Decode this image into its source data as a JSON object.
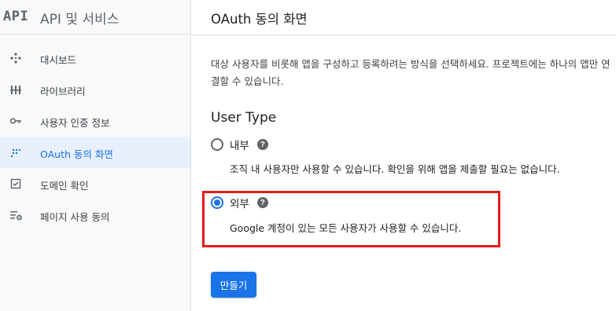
{
  "sidebar": {
    "logo": "API",
    "title": "API 및 서비스",
    "items": [
      {
        "label": "대시보드",
        "icon": "dashboard-icon"
      },
      {
        "label": "라이브러리",
        "icon": "library-icon"
      },
      {
        "label": "사용자 인증 정보",
        "icon": "key-icon"
      },
      {
        "label": "OAuth 동의 화면",
        "icon": "oauth-consent-icon",
        "active": true
      },
      {
        "label": "도메인 확인",
        "icon": "checkbox-icon"
      },
      {
        "label": "페이지 사용 동의",
        "icon": "settings-list-icon"
      }
    ]
  },
  "main": {
    "title": "OAuth 동의 화면",
    "description": "대상 사용자를 비롯해 앱을 구성하고 등록하려는 방식을 선택하세요. 프로젝트에는 하나의 앱만 연결할 수 있습니다.",
    "user_type": {
      "heading": "User Type",
      "options": [
        {
          "label": "내부",
          "description": "조직 내 사용자만 사용할 수 있습니다. 확인을 위해 앱을 제출할 필요는 없습니다.",
          "selected": false
        },
        {
          "label": "외부",
          "description": "Google 계정이 있는 모든 사용자가 사용할 수 있습니다.",
          "selected": true
        }
      ],
      "help_glyph": "?"
    },
    "create_button": "만들기"
  },
  "colors": {
    "accent": "#1a73e8",
    "highlight": "#e41b1b",
    "sidebar_bg": "#f8f9fa",
    "active_bg": "#e8f0fe"
  }
}
